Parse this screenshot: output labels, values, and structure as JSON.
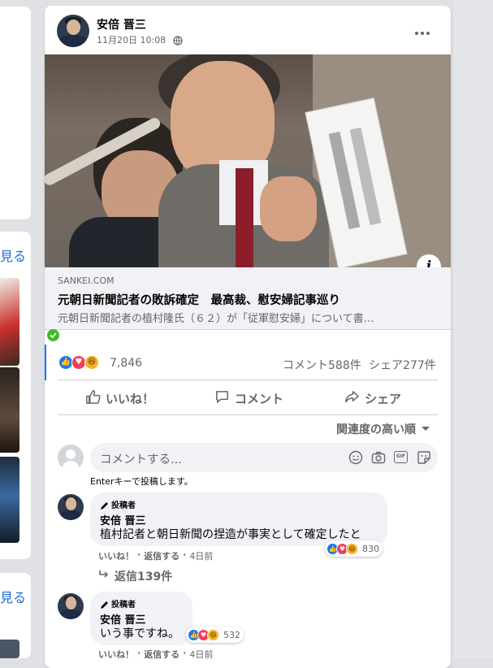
{
  "left_column": {
    "see_more_1": "見る",
    "see_more_2": "見る"
  },
  "post": {
    "author": "安倍 晋三",
    "timestamp": "11月20日 10:08",
    "privacy_icon": "globe-icon",
    "more_icon": "more-dots-icon",
    "link": {
      "domain": "SANKEI.COM",
      "title": "元朝日新聞記者の敗訴確定　最高裁、慰安婦記事巡り",
      "description": "元朝日新聞記者の植村隆氏（６２）が「従軍慰安婦」について書…"
    },
    "reactions": {
      "count": "7,846",
      "comments": "コメント588件",
      "shares": "シェア277件"
    },
    "actions": {
      "like": "いいね！",
      "comment": "コメント",
      "share": "シェア"
    },
    "sort_label": "関連度の高い順",
    "composer": {
      "placeholder": "コメントする...",
      "hint": "Enterキーで投稿します。"
    }
  },
  "comments": [
    {
      "role": "投稿者",
      "author": "安倍 晋三",
      "text": "植村記者と朝日新聞の捏造が事実として確定したと",
      "like": "いいね！",
      "reply": "返信する",
      "time": "4日前",
      "reaction_count": "830",
      "replies": "返信139件"
    },
    {
      "role": "投稿者",
      "author": "安倍 晋三",
      "text": "いう事ですね。",
      "like": "いいね！",
      "reply": "返信する",
      "time": "4日前",
      "reaction_count": "532"
    }
  ],
  "separator": "·",
  "colors": {
    "accent": "#1877f2",
    "link": "#216fdb",
    "muted": "#65676b",
    "love": "#f33e58",
    "haha": "#f7b125"
  }
}
